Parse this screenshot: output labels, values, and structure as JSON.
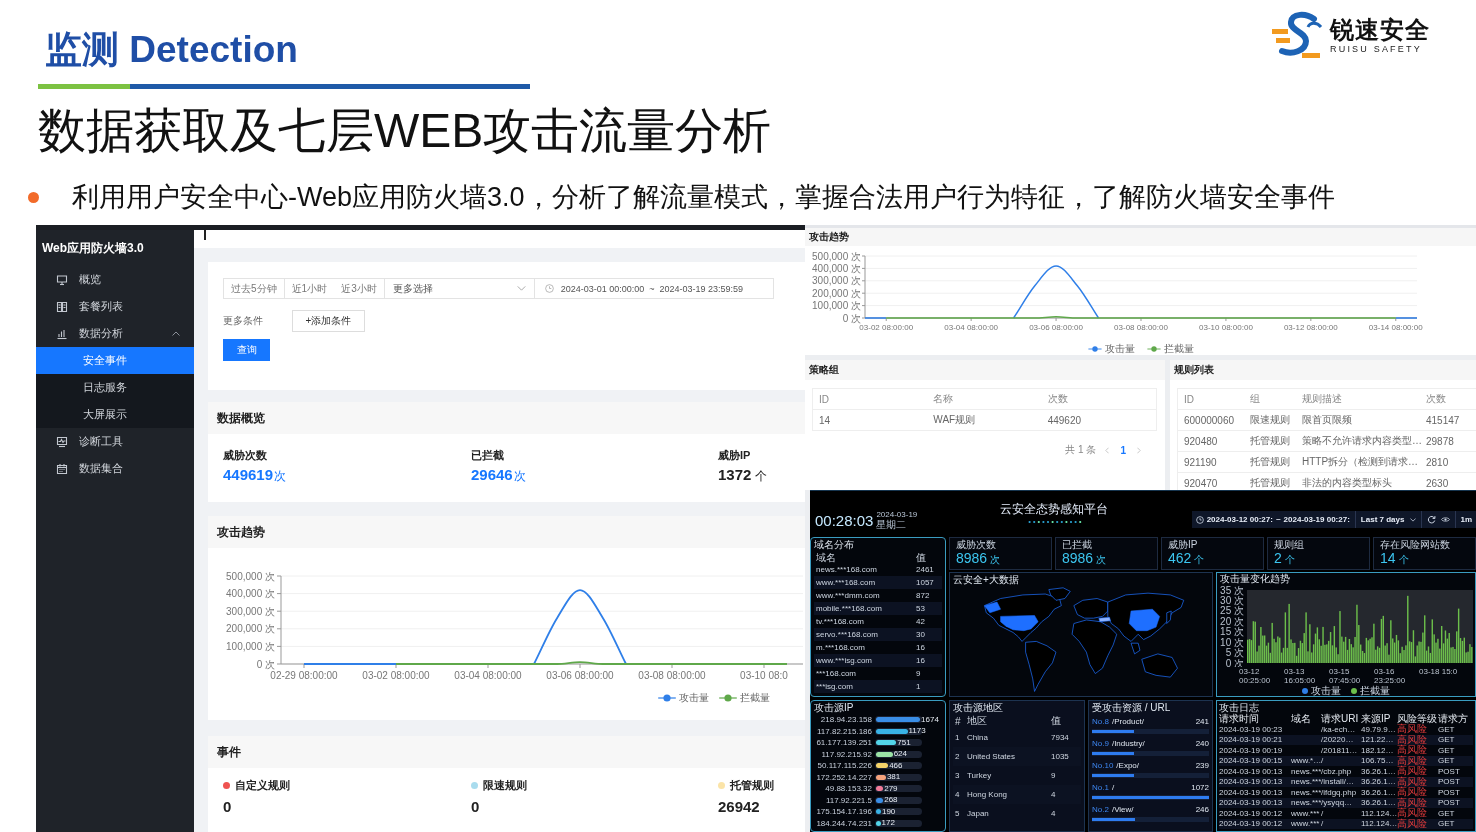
{
  "header": {
    "section": "监测 Detection",
    "title": "数据获取及七层WEB攻击流量分析",
    "bullets": [
      "利用用户安全中心-Web应用防火墙3.0，分析了解流量模式，掌握合法用户行为特征，了解防火墙安全事件"
    ]
  },
  "logo": {
    "name": "锐速安全",
    "tagline": "RUISU SAFETY"
  },
  "console": {
    "sidebar": {
      "title": "Web应用防火墙3.0",
      "items": [
        {
          "label": "概览",
          "selected": false,
          "expanded": false
        },
        {
          "label": "套餐列表",
          "selected": false,
          "expanded": false
        },
        {
          "label": "数据分析",
          "selected": false,
          "expanded": true,
          "children": [
            {
              "label": "安全事件",
              "selected": true
            },
            {
              "label": "日志服务",
              "selected": false
            },
            {
              "label": "大屏展示",
              "selected": false
            }
          ]
        },
        {
          "label": "诊断工具",
          "selected": false,
          "expanded": false
        },
        {
          "label": "数据集合",
          "selected": false,
          "expanded": false
        }
      ]
    },
    "filters": {
      "quick_ranges": [
        "过去5分钟",
        "近1小时",
        "近3小时"
      ],
      "more_select": "更多选择",
      "date_start": "2024-03-01 00:00:00",
      "date_separator": "~",
      "date_end": "2024-03-19 23:59:59",
      "more_label": "更多条件",
      "add_button": "+添加条件",
      "query_button": "查询"
    },
    "overview": {
      "title": "数据概览",
      "stats": [
        {
          "label": "威胁次数",
          "value": "449619",
          "unit": "次",
          "kind": "accent"
        },
        {
          "label": "已拦截",
          "value": "29646",
          "unit": "次",
          "kind": "accent"
        },
        {
          "label": "威胁IP",
          "value": "1372",
          "unit": "个",
          "kind": "plain"
        }
      ]
    },
    "trend": {
      "title": "攻击趋势",
      "chart_data": {
        "type": "line",
        "categories": [
          "02-29 08:00:00",
          null,
          null,
          null,
          "03-02 08:00:00",
          null,
          null,
          null,
          "03-04 08:00:00",
          null,
          null,
          null,
          "03-06 08:00:00",
          null,
          null,
          null,
          "03-08 08:00:00",
          null,
          null,
          null,
          "03-10 08:0",
          null
        ],
        "series": [
          {
            "name": "攻击量",
            "color": "#2f7fe8",
            "values": [
              0,
              0,
              0,
              0,
              0,
              null,
              null,
              null,
              null,
              null,
              0,
              260000,
              420000,
              260000,
              0,
              null,
              null,
              null,
              null,
              null,
              null,
              null
            ]
          },
          {
            "name": "拦截量",
            "color": "#5fa84a",
            "values": [
              null,
              null,
              null,
              null,
              0,
              0,
              0,
              0,
              0,
              0,
              0,
              0,
              10000,
              0,
              0,
              0,
              0,
              0,
              0,
              0,
              0,
              0
            ]
          }
        ],
        "ylim": [
          0,
          500000
        ],
        "yticks": [
          {
            "value": 0,
            "label": "0 次"
          },
          {
            "value": 100000,
            "label": "100,000 次"
          },
          {
            "value": 200000,
            "label": "200,000 次"
          },
          {
            "value": 300000,
            "label": "300,000 次"
          },
          {
            "value": 400000,
            "label": "400,000 次"
          },
          {
            "value": 500000,
            "label": "500,000 次"
          }
        ],
        "grid": true,
        "legend": true
      }
    },
    "events": {
      "title": "事件",
      "items": [
        {
          "label": "自定义规则",
          "value": "0",
          "color": "#ef5350"
        },
        {
          "label": "限速规则",
          "value": "0",
          "color": "#a9dcee"
        },
        {
          "label": "托管规则",
          "value": "26942",
          "color": "#fbe4a8"
        }
      ]
    }
  },
  "trend_panel": {
    "title": "攻击趋势",
    "chart_data": {
      "type": "line",
      "categories": [
        null,
        "03-02 08:00:00",
        null,
        null,
        null,
        "03-04 08:00:00",
        null,
        null,
        null,
        "03-06 08:00:00",
        null,
        null,
        null,
        "03-08 08:00:00",
        null,
        null,
        null,
        "03-10 08:00:00",
        null,
        null,
        null,
        "03-12 08:00:00",
        null,
        null,
        null,
        "03-14 08:00:00",
        null
      ],
      "series": [
        {
          "name": "攻击量",
          "color": "#2f7fe8",
          "values": [
            0,
            0,
            null,
            null,
            null,
            null,
            null,
            0,
            260000,
            420000,
            260000,
            0,
            null,
            null,
            null,
            null,
            null,
            null,
            null,
            null,
            null,
            null,
            null,
            null,
            null,
            0,
            0
          ]
        },
        {
          "name": "拦截量",
          "color": "#5fa84a",
          "values": [
            null,
            0,
            0,
            0,
            0,
            0,
            0,
            0,
            0,
            10000,
            0,
            0,
            0,
            0,
            0,
            0,
            0,
            0,
            0,
            0,
            0,
            0,
            0,
            0,
            0,
            0,
            null
          ]
        }
      ],
      "ylim": [
        0,
        500000
      ],
      "yticks": [
        {
          "value": 0,
          "label": "0 次"
        },
        {
          "value": 100000,
          "label": "100,000 次"
        },
        {
          "value": 200000,
          "label": "200,000 次"
        },
        {
          "value": 300000,
          "label": "300,000 次"
        },
        {
          "value": 400000,
          "label": "400,000 次"
        },
        {
          "value": 500000,
          "label": "500,000 次"
        }
      ],
      "grid": true,
      "legend": true
    }
  },
  "policy_group": {
    "title": "策略组",
    "columns": [
      "ID",
      "名称",
      "次数"
    ],
    "rows": [
      [
        "14",
        "WAF规则",
        "449620"
      ]
    ],
    "pagination": {
      "total": "共 1 条",
      "pages": [
        {
          "label": "1",
          "selected": true
        }
      ]
    }
  },
  "rule_list": {
    "title": "规则列表",
    "columns": [
      "ID",
      "组",
      "规则描述",
      "次数"
    ],
    "rows": [
      [
        "600000060",
        "限速规则",
        "限首页限频",
        "415147"
      ],
      [
        "920480",
        "托管规则",
        "策略不允许请求内容类型…",
        "29878"
      ],
      [
        "921190",
        "托管规则",
        "HTTP拆分（检测到请求…",
        "2810"
      ],
      [
        "920470",
        "托管规则",
        "非法的内容类型标头",
        "2630"
      ]
    ]
  },
  "dashboard": {
    "title": "云安全态势感知平台",
    "clock": "00:28:03",
    "date": "2024-03-19",
    "weekday": "星期二",
    "range": {
      "start": "2024-03-12 00:27:",
      "separator": "~",
      "end": "2024-03-19 00:27:",
      "preset": "Last 7 days",
      "interval": "1m"
    },
    "stats": [
      {
        "label": "威胁次数",
        "value": "8986",
        "unit": "次"
      },
      {
        "label": "已拦截",
        "value": "8986",
        "unit": "次"
      },
      {
        "label": "威胁IP",
        "value": "462",
        "unit": "个"
      },
      {
        "label": "规则组",
        "value": "2",
        "unit": "个"
      },
      {
        "label": "存在风险网站数",
        "value": "14",
        "unit": "个"
      }
    ],
    "domains": {
      "title": "域名分布",
      "columns": [
        "域名",
        "值"
      ],
      "rows": [
        [
          "news.***168.com",
          "2461"
        ],
        [
          "www.***168.com",
          "1057"
        ],
        [
          "www.***dmm.com",
          "872"
        ],
        [
          "mobile.***168.com",
          "53"
        ],
        [
          "tv.***168.com",
          "42"
        ],
        [
          "servo.***168.com",
          "30"
        ],
        [
          "m.***168.com",
          "16"
        ],
        [
          "www.***isg.com",
          "16"
        ],
        [
          "***168.com",
          "9"
        ],
        [
          "***isg.com",
          "1"
        ]
      ]
    },
    "map": {
      "title": "云安全+大数据"
    },
    "attack_chart": {
      "title": "攻击量变化趋势",
      "y_labels": [
        "35 次",
        "30 次",
        "25 次",
        "20 次",
        "15 次",
        "10 次",
        "5 次",
        "0 次"
      ],
      "x_labels": [
        "03-12 00:25:00",
        "03-13 16:05:00",
        "03-15 07:45:00",
        "03-16 23:25:00",
        "03-18 15:0"
      ],
      "legend": [
        {
          "name": "攻击量",
          "color": "#2f7fe8"
        },
        {
          "name": "拦截量",
          "color": "#6cbf4b"
        }
      ]
    },
    "source_ips": {
      "title": "攻击源IP",
      "items": [
        {
          "ip": "218.94.23.158",
          "value": "1674",
          "level": 0.98,
          "color": "#3a8ee6"
        },
        {
          "ip": "117.82.215.186",
          "value": "1173",
          "level": 0.7,
          "color": "#39b3e6"
        },
        {
          "ip": "61.177.139.251",
          "value": "751",
          "level": 0.45,
          "color": "#53d5e8"
        },
        {
          "ip": "117.92.215.92",
          "value": "624",
          "level": 0.37,
          "color": "#9be3a6"
        },
        {
          "ip": "50.117.115.226",
          "value": "466",
          "level": 0.27,
          "color": "#f4d268"
        },
        {
          "ip": "172.252.14.227",
          "value": "381",
          "level": 0.22,
          "color": "#f4a27c"
        },
        {
          "ip": "49.88.153.32",
          "value": "279",
          "level": 0.16,
          "color": "#f07a98"
        },
        {
          "ip": "117.92.221.5",
          "value": "268",
          "level": 0.16,
          "color": "#3a8ee6"
        },
        {
          "ip": "175.154.17.196",
          "value": "190",
          "level": 0.11,
          "color": "#39b3e6"
        },
        {
          "ip": "184.244.74.231",
          "value": "172",
          "level": 0.1,
          "color": "#53d5e8"
        }
      ]
    },
    "regions": {
      "title": "攻击源地区",
      "columns": [
        "#",
        "地区",
        "值"
      ],
      "rows": [
        [
          "1",
          "China",
          "7934"
        ],
        [
          "2",
          "United States",
          "1035"
        ],
        [
          "3",
          "Turkey",
          "9"
        ],
        [
          "4",
          "Hong Kong",
          "4"
        ],
        [
          "5",
          "Japan",
          "4"
        ]
      ]
    },
    "urls": {
      "title": "受攻击资源 / URL",
      "items": [
        {
          "rank": "No.8",
          "path": "/Product/",
          "value": "241",
          "level": 0.36
        },
        {
          "rank": "No.9",
          "path": "/Industry/",
          "value": "240",
          "level": 0.36
        },
        {
          "rank": "No.10",
          "path": "/Expo/",
          "value": "239",
          "level": 0.36
        },
        {
          "rank": "No.1",
          "path": "/",
          "value": "1072",
          "level": 1
        },
        {
          "rank": "No.2",
          "path": "/View/",
          "value": "246",
          "level": 0.37
        }
      ]
    },
    "log": {
      "title": "攻击日志",
      "columns": [
        "请求时间",
        "域名",
        "请求URI",
        "来源IP",
        "风险等级",
        "请求方"
      ],
      "rows": [
        {
          "time": "2024-03-19 00:23",
          "uri": "/ka-ech…",
          "ip": "49.79.9…",
          "risk": "高风险",
          "method": "GET"
        },
        {
          "time": "2024-03-19 00:21",
          "uri": "/20220…",
          "ip": "121.22…",
          "risk": "高风险",
          "method": "GET"
        },
        {
          "time": "2024-03-19 00:19",
          "uri": "/201811…",
          "ip": "182.12…",
          "risk": "高风险",
          "method": "GET"
        },
        {
          "time": "2024-03-19 00:15",
          "domain": "www.*…",
          "uri": "/",
          "ip": "106.75…",
          "risk": "高风险",
          "method": "GET"
        },
        {
          "time": "2024-03-19 00:13",
          "domain": "news.***",
          "uri": "/cbz.php",
          "ip": "36.26.1…",
          "risk": "高风险",
          "method": "POST"
        },
        {
          "time": "2024-03-19 00:13",
          "domain": "news.***",
          "uri": "/install/…",
          "ip": "36.26.1…",
          "risk": "高风险",
          "method": "POST"
        },
        {
          "time": "2024-03-19 00:13",
          "domain": "news.***",
          "uri": "/ifdgq.php",
          "ip": "36.26.1…",
          "risk": "高风险",
          "method": "POST"
        },
        {
          "time": "2024-03-19 00:13",
          "domain": "news.***",
          "uri": "/ysyqq…",
          "ip": "36.26.1…",
          "risk": "高风险",
          "method": "POST"
        },
        {
          "time": "2024-03-19 00:12",
          "domain": "www.***",
          "uri": "/",
          "ip": "112.124…",
          "risk": "高风险",
          "method": "GET"
        },
        {
          "time": "2024-03-19 00:12",
          "domain": "www.***",
          "uri": "/",
          "ip": "112.124…",
          "risk": "高风险",
          "method": "GET"
        }
      ]
    }
  }
}
